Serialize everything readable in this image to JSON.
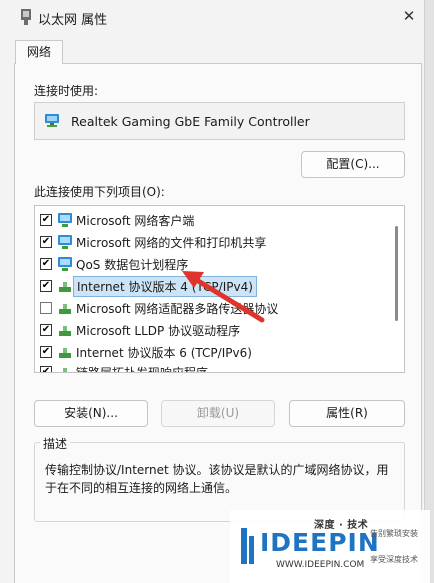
{
  "window": {
    "title": "以太网 属性",
    "close_glyph": "✕"
  },
  "tabs": [
    {
      "label": "网络"
    }
  ],
  "connect_using": {
    "label": "连接时使用:",
    "adapter_name": "Realtek Gaming GbE Family Controller",
    "configure_label": "配置(C)..."
  },
  "items_section": {
    "label": "此连接使用下列项目(O):",
    "items": [
      {
        "checked": true,
        "check_glyph": "✔",
        "icon": "network-client-icon",
        "label": "Microsoft 网络客户端"
      },
      {
        "checked": true,
        "check_glyph": "✔",
        "icon": "network-share-icon",
        "label": "Microsoft 网络的文件和打印机共享"
      },
      {
        "checked": true,
        "check_glyph": "✔",
        "icon": "qos-icon",
        "label": "QoS 数据包计划程序"
      },
      {
        "checked": true,
        "check_glyph": "✔",
        "icon": "protocol-icon",
        "label": "Internet 协议版本 4 (TCP/IPv4)",
        "selected": true
      },
      {
        "checked": false,
        "check_glyph": "",
        "icon": "protocol-icon",
        "label": "Microsoft 网络适配器多路传送器协议"
      },
      {
        "checked": true,
        "check_glyph": "✔",
        "icon": "protocol-icon",
        "label": "Microsoft LLDP 协议驱动程序"
      },
      {
        "checked": true,
        "check_glyph": "✔",
        "icon": "protocol-icon",
        "label": "Internet 协议版本 6 (TCP/IPv6)"
      },
      {
        "checked": true,
        "check_glyph": "✔",
        "icon": "protocol-icon",
        "label": "链路层拓扑发现响应程序"
      }
    ]
  },
  "buttons": {
    "install": "安装(N)...",
    "uninstall": "卸载(U)",
    "properties": "属性(R)"
  },
  "description": {
    "title": "描述",
    "text": "传输控制协议/Internet 协议。该协议是默认的广域网络协议，用于在不同的相互连接的网络上通信。"
  },
  "watermark": {
    "top": "深度 · 技术",
    "brand": "IDEEPIN",
    "url": "WWW.IDEEPIN.COM",
    "side_1": "告别繁琐安装",
    "side_2": "享受深度技术"
  },
  "colors": {
    "selection": "#cde4f7",
    "arrow": "#e0332a",
    "brand": "#1e73c2"
  }
}
